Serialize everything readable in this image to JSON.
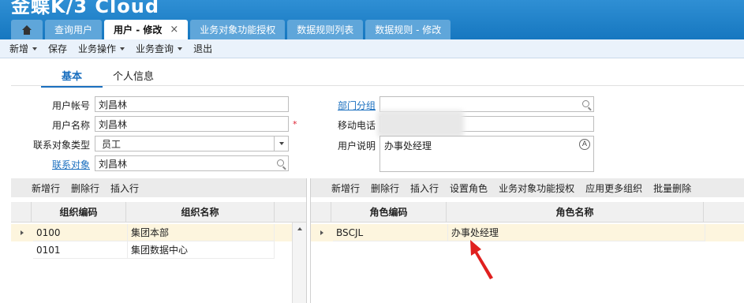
{
  "app": {
    "brand": "金蝶K/3 Cloud"
  },
  "tabs": [
    {
      "label": "查询用户"
    },
    {
      "label": "用户 - 修改",
      "close": "×"
    },
    {
      "label": "业务对象功能授权"
    },
    {
      "label": "数据规则列表"
    },
    {
      "label": "数据规则 - 修改"
    }
  ],
  "menu": [
    "新增",
    "保存",
    "业务操作",
    "业务查询",
    "退出"
  ],
  "subtabs": [
    "基本",
    "个人信息"
  ],
  "form": {
    "user_account_label": "用户帐号",
    "user_account": "刘昌林",
    "user_name_label": "用户名称",
    "user_name": "刘昌林",
    "required": "*",
    "contact_type_label": "联系对象类型",
    "contact_type": "员工",
    "contact_label": "联系对象",
    "contact": "刘昌林",
    "dept_label": "部门分组",
    "dept": "",
    "phone_label": "移动电话",
    "desc_label": "用户说明",
    "desc": "办事处经理"
  },
  "left_grid": {
    "toolbar": [
      "新增行",
      "删除行",
      "插入行"
    ],
    "headers": [
      "组织编码",
      "组织名称"
    ],
    "rows": [
      {
        "code": "0100",
        "name": "集团本部"
      },
      {
        "code": "0101",
        "name": "集团数据中心"
      }
    ]
  },
  "right_grid": {
    "toolbar": [
      "新增行",
      "删除行",
      "插入行",
      "设置角色",
      "业务对象功能授权",
      "应用更多组织",
      "批量删除"
    ],
    "headers": [
      "角色编码",
      "角色名称"
    ],
    "rows": [
      {
        "code": "BSCJL",
        "name": "办事处经理"
      }
    ]
  },
  "colors": {
    "accent": "#1a6fbf",
    "annotation": "#e0201f",
    "selected_row": "#fdf5de"
  }
}
